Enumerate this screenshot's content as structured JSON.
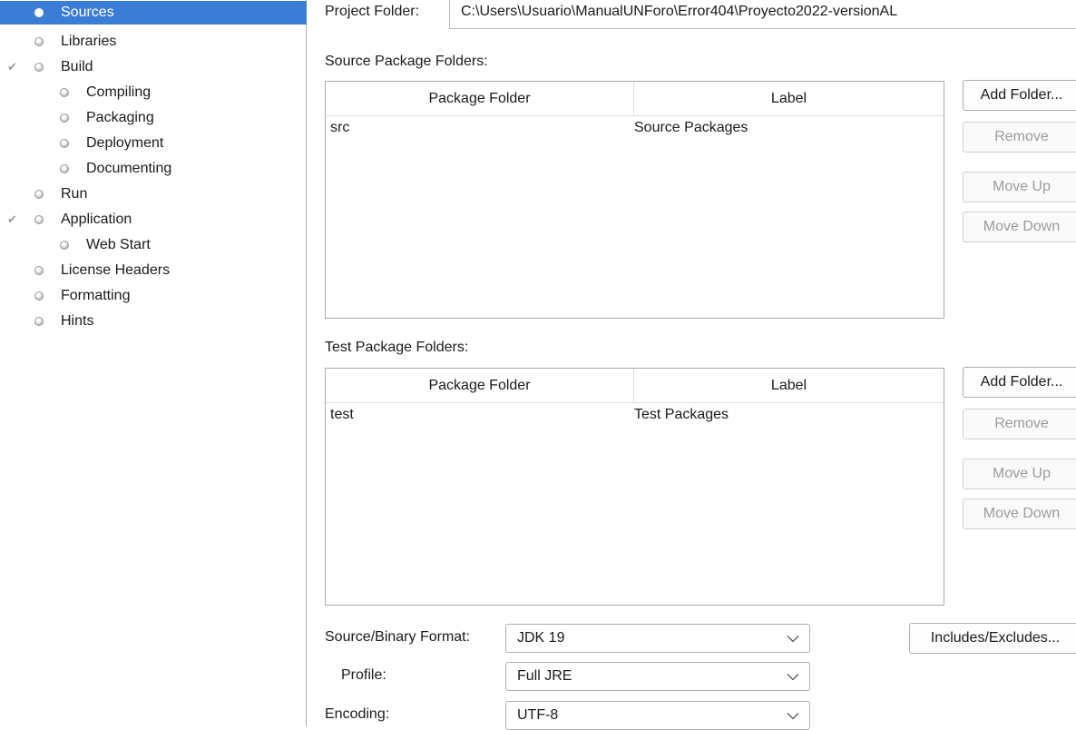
{
  "tree": [
    {
      "label": "Sources",
      "indent": 0,
      "selected": true,
      "checked": false
    },
    {
      "label": "Libraries",
      "indent": 0,
      "selected": false,
      "checked": false
    },
    {
      "label": "Build",
      "indent": 0,
      "selected": false,
      "checked": true
    },
    {
      "label": "Compiling",
      "indent": 1,
      "selected": false,
      "checked": false
    },
    {
      "label": "Packaging",
      "indent": 1,
      "selected": false,
      "checked": false
    },
    {
      "label": "Deployment",
      "indent": 1,
      "selected": false,
      "checked": false
    },
    {
      "label": "Documenting",
      "indent": 1,
      "selected": false,
      "checked": false
    },
    {
      "label": "Run",
      "indent": 0,
      "selected": false,
      "checked": false
    },
    {
      "label": "Application",
      "indent": 0,
      "selected": false,
      "checked": true
    },
    {
      "label": "Web Start",
      "indent": 1,
      "selected": false,
      "checked": false
    },
    {
      "label": "License Headers",
      "indent": 0,
      "selected": false,
      "checked": false
    },
    {
      "label": "Formatting",
      "indent": 0,
      "selected": false,
      "checked": false
    },
    {
      "label": "Hints",
      "indent": 0,
      "selected": false,
      "checked": false
    }
  ],
  "project_folder": {
    "label": "Project Folder:",
    "value": "C:\\Users\\Usuario\\ManualUNForo\\Error404\\Proyecto2022-versionAL"
  },
  "source_folders": {
    "title": "Source Package Folders:",
    "columns": [
      "Package Folder",
      "Label"
    ],
    "rows": [
      [
        "src",
        "Source Packages"
      ]
    ],
    "buttons": {
      "add": "Add Folder...",
      "remove": "Remove",
      "move_up": "Move Up",
      "move_down": "Move Down"
    }
  },
  "test_folders": {
    "title": "Test Package Folders:",
    "columns": [
      "Package Folder",
      "Label"
    ],
    "rows": [
      [
        "test",
        "Test Packages"
      ]
    ],
    "buttons": {
      "add": "Add Folder...",
      "remove": "Remove",
      "move_up": "Move Up",
      "move_down": "Move Down"
    }
  },
  "format": {
    "source_binary_label": "Source/Binary Format:",
    "source_binary_value": "JDK 19",
    "profile_label": "Profile:",
    "profile_value": "Full JRE",
    "encoding_label": "Encoding:",
    "encoding_value": "UTF-8",
    "includes_button": "Includes/Excludes..."
  },
  "colors": {
    "selection": "#3b7cd6",
    "disabled_text": "#9b9b9b",
    "border": "#a9a9a9"
  }
}
